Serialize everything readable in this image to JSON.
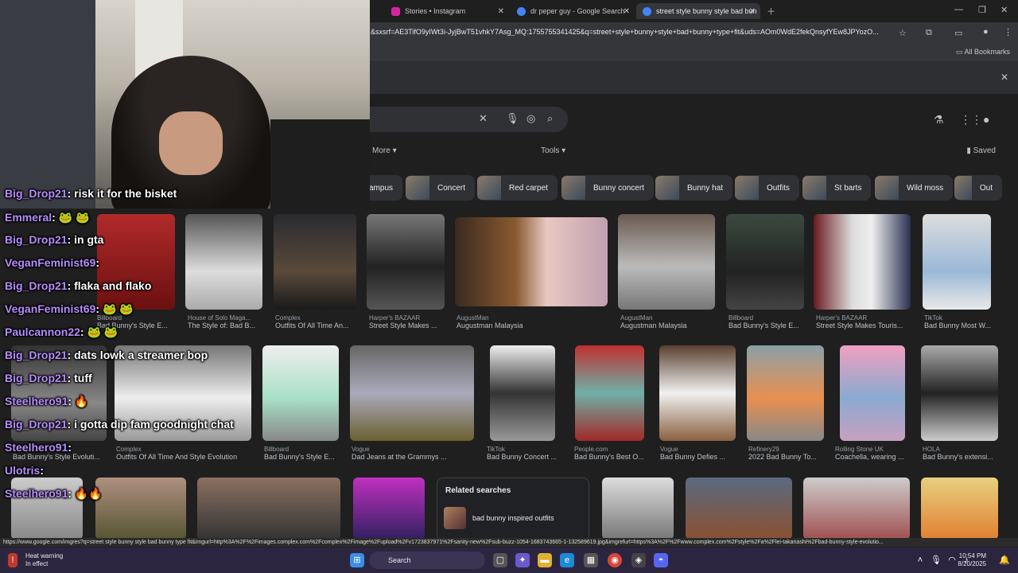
{
  "tabs": [
    {
      "label": "Stories • Instagram",
      "color": "#d6249f"
    },
    {
      "label": "dr peper guy - Google Search",
      "color": "#4285f4"
    },
    {
      "label": "street style bunny style bad bun",
      "color": "#4285f4"
    }
  ],
  "address": {
    "url": "&sxsrf=AE3TifO9yIWt3i-JyjBwT51vhkY7Asg_MQ:1755755341425&q=street+style+bunny+style+bad+bunny+type+fit&uds=AOm0WdE2fekQnsyfYEw8JPYozO..."
  },
  "bookmarks": {
    "all": "All Bookmarks"
  },
  "search": {
    "more": "More",
    "tools": "Tools",
    "saved": "Saved"
  },
  "chips": [
    "ampus",
    "Concert",
    "Red carpet",
    "Bunny concert",
    "Bunny hat",
    "Outfits",
    "St barts",
    "Wild moss",
    "Out"
  ],
  "row1": [
    {
      "src": "Billboard",
      "title": "Bad Bunny's Style E..."
    },
    {
      "src": "House of Solo Maga...",
      "title": "The Style of: Bad B..."
    },
    {
      "src": "Complex",
      "title": "Outfits Of All Time An..."
    },
    {
      "src": "Harper's BAZAAR",
      "title": "Street Style Makes ..."
    },
    {
      "src": "AugustMan",
      "title": "Augustman Malaysia"
    },
    {
      "src": "AugustMan",
      "title": "Augustman Malaysia"
    },
    {
      "src": "Billboard",
      "title": "Bad Bunny's Style E..."
    },
    {
      "src": "Harper's BAZAAR",
      "title": "Street Style Makes Touris..."
    },
    {
      "src": "TikTok",
      "title": "Bad Bunny Most W..."
    }
  ],
  "row2": [
    {
      "src": "Complex",
      "title": "Bad Bunny's Style Evoluti..."
    },
    {
      "src": "Complex",
      "title": "Outfits Of All Time And Style Evolution"
    },
    {
      "src": "Billboard",
      "title": "Bad Bunny's Style E..."
    },
    {
      "src": "Vogue",
      "title": "Dad Jeans at the Grammys ..."
    },
    {
      "src": "TikTok",
      "title": "Bad Bunny Concert ..."
    },
    {
      "src": "People.com",
      "title": "Bad Bunny's Best O..."
    },
    {
      "src": "Vogue",
      "title": "Bad Bunny Defies ..."
    },
    {
      "src": "Refinery29",
      "title": "2022 Bad Bunny To..."
    },
    {
      "src": "Rolling Stone UK",
      "title": "Coachella, wearing ..."
    },
    {
      "src": "HOLA",
      "title": "Bad Bunny's extensi..."
    }
  ],
  "related": {
    "heading": "Related searches",
    "item": "bad bunny inspired outfits"
  },
  "status_url": "https://www.google.com/imgres?q=street style bunny style bad bunny type fit&imgurl=http%3A%2F%2Fimages.complex.com%2Fcomplex%2Fimage%2Fupload%2Fv1723837971%2Fsanity-new%2Fsub-buzz-1054-1683743665-1-132589619.jpg&imgrefurl=https%3A%2F%2Fwww.complex.com%2Fstyle%2Fa%2Flei-takanashi%2Fbad-bunny-style-evolutio...",
  "taskbar": {
    "warn_title": "Heat warning",
    "warn_sub": "In effect",
    "search": "Search",
    "time": "10:54 PM",
    "date": "8/20/2025"
  },
  "chat": [
    {
      "user": "Big_Drop21",
      "body": ": risk it for the bisket"
    },
    {
      "user": "Emmeral",
      "body": ": 🐸 🐸"
    },
    {
      "user": "Big_Drop21",
      "body": ": in gta"
    },
    {
      "user": "VeganFeminist69",
      "body": ":"
    },
    {
      "user": "Big_Drop21",
      "body": ": flaka and flako"
    },
    {
      "user": "VeganFeminist69",
      "body": ": 🐸 🐸"
    },
    {
      "user": "Paulcannon22",
      "body": ": 🐸 🐸"
    },
    {
      "user": "Big_Drop21",
      "body": ": dats lowk a streamer bop"
    },
    {
      "user": "Big_Drop21",
      "body": ": tuff"
    },
    {
      "user": "Steelhero91",
      "body": ": 🔥"
    },
    {
      "user": "Big_Drop21",
      "body": ": i gotta dip fam goodnight chat"
    },
    {
      "user": "Steelhero91",
      "body": ":"
    },
    {
      "user": "Ulotris",
      "body": ":"
    },
    {
      "user": "Steelhero91",
      "body": ": 🔥🔥"
    }
  ]
}
